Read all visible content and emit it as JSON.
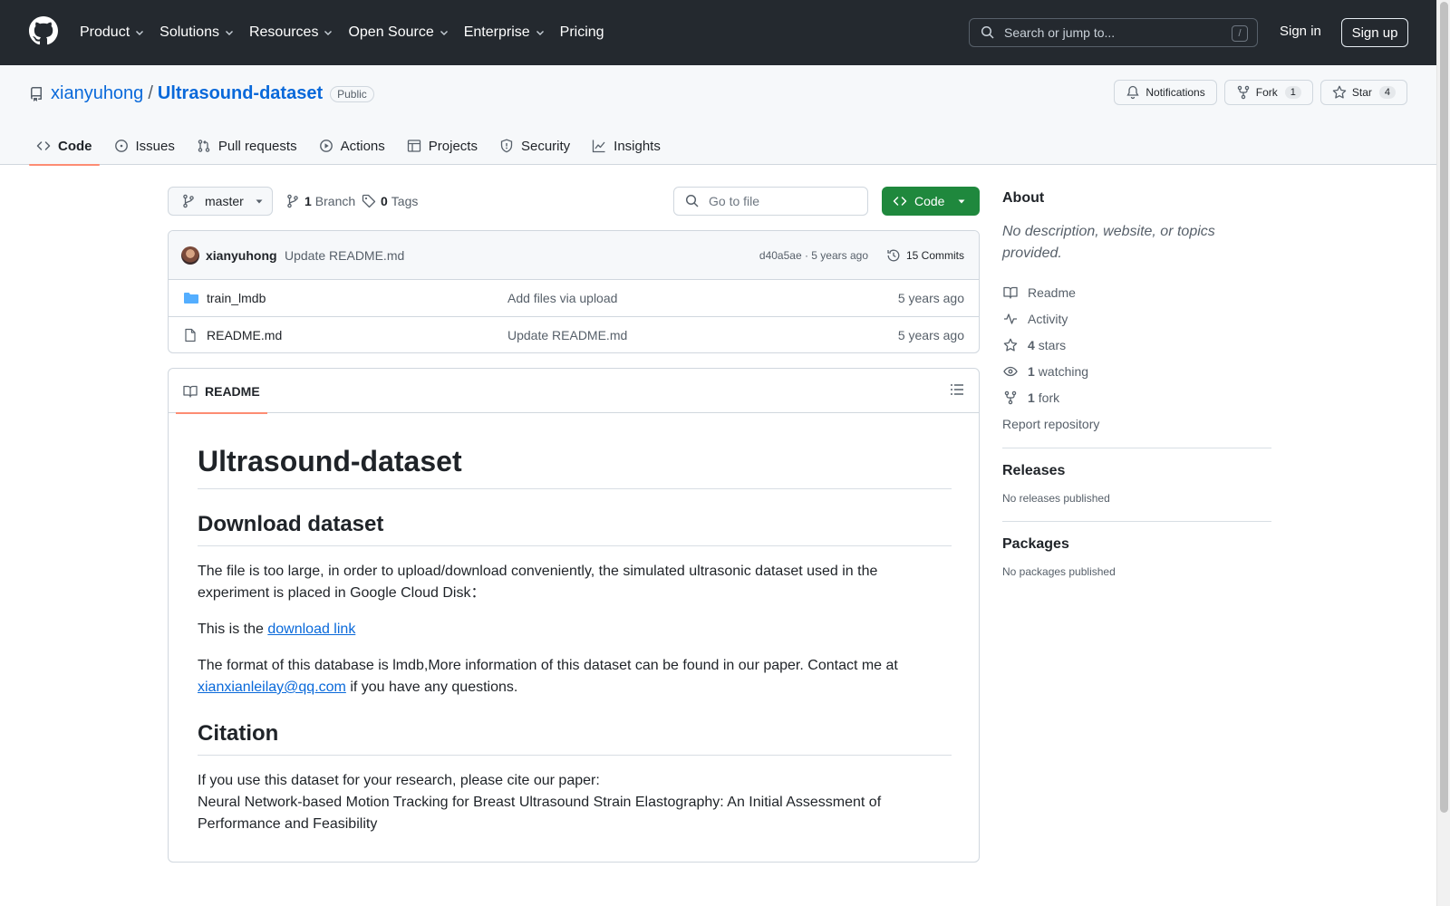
{
  "nav": {
    "items": [
      {
        "label": "Product",
        "dropdown": true
      },
      {
        "label": "Solutions",
        "dropdown": true
      },
      {
        "label": "Resources",
        "dropdown": true
      },
      {
        "label": "Open Source",
        "dropdown": true
      },
      {
        "label": "Enterprise",
        "dropdown": true
      },
      {
        "label": "Pricing",
        "dropdown": false
      }
    ],
    "search_placeholder": "Search or jump to...",
    "search_shortcut": "/",
    "sign_in": "Sign in",
    "sign_up": "Sign up"
  },
  "repo": {
    "owner": "xianyuhong",
    "separator": "/",
    "name": "Ultrasound-dataset",
    "visibility": "Public",
    "actions": {
      "notifications": "Notifications",
      "fork": "Fork",
      "fork_count": "1",
      "star": "Star",
      "star_count": "4"
    },
    "tabs": [
      {
        "label": "Code",
        "icon": "code-icon",
        "active": true
      },
      {
        "label": "Issues",
        "icon": "issue-icon"
      },
      {
        "label": "Pull requests",
        "icon": "pull-request-icon"
      },
      {
        "label": "Actions",
        "icon": "play-icon"
      },
      {
        "label": "Projects",
        "icon": "table-icon"
      },
      {
        "label": "Security",
        "icon": "shield-icon"
      },
      {
        "label": "Insights",
        "icon": "graph-icon"
      }
    ]
  },
  "toolbar": {
    "branch": "master",
    "branch_count": "1",
    "branch_label": "Branch",
    "tag_count": "0",
    "tag_label": "Tags",
    "goto_placeholder": "Go to file",
    "code_button": "Code"
  },
  "commit": {
    "author": "xianyuhong",
    "message": "Update README.md",
    "sha_time": "d40a5ae · 5 years ago",
    "commits": "15 Commits"
  },
  "files": [
    {
      "name": "train_lmdb",
      "type": "folder",
      "message": "Add files via upload",
      "time": "5 years ago"
    },
    {
      "name": "README.md",
      "type": "file",
      "message": "Update README.md",
      "time": "5 years ago"
    }
  ],
  "readme": {
    "tab": "README",
    "h1": "Ultrasound-dataset",
    "h2_download": "Download dataset",
    "p1": "The file is too large, in order to upload/download conveniently, the simulated ultrasonic dataset used in the experiment is placed in Google Cloud Disk：",
    "p2_prefix": "This is the ",
    "p2_link": "download link",
    "p3_text": "The format of this database is lmdb,More information of this dataset can be found in our paper. Contact me at ",
    "p3_email": "xianxianleilay@qq.com",
    "p3_suffix": " if you have any questions.",
    "h2_citation": "Citation",
    "cite_line1": "If you use this dataset for your research, please cite our paper:",
    "cite_line2": "Neural Network-based Motion Tracking for Breast Ultrasound Strain Elastography: An Initial Assessment of Performance and Feasibility"
  },
  "sidebar": {
    "about": "About",
    "description": "No description, website, or topics provided.",
    "readme": "Readme",
    "activity": "Activity",
    "stars_count": "4",
    "stars_label": "stars",
    "watching_count": "1",
    "watching_label": "watching",
    "fork_count": "1",
    "fork_label": "fork",
    "report": "Report repository",
    "releases": "Releases",
    "releases_empty": "No releases published",
    "packages": "Packages",
    "packages_empty": "No packages published"
  }
}
